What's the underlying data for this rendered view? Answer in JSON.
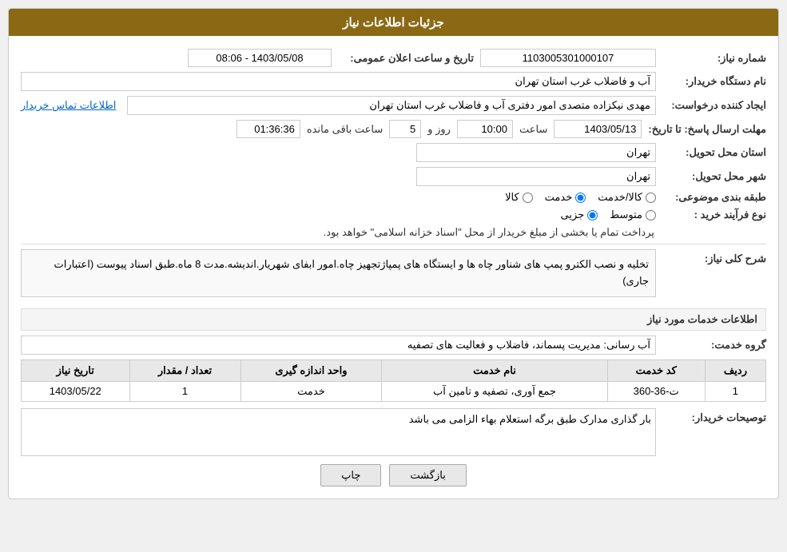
{
  "header": {
    "title": "جزئیات اطلاعات نیاز"
  },
  "fields": {
    "need_number_label": "شماره نیاز:",
    "need_number_value": "1103005301000107",
    "announce_datetime_label": "تاریخ و ساعت اعلان عمومی:",
    "announce_datetime_value": "1403/05/08 - 08:06",
    "buyer_org_label": "نام دستگاه خریدار:",
    "buyer_org_value": "آب و فاضلاب غرب استان تهران",
    "creator_label": "ایجاد کننده درخواست:",
    "creator_value": "مهدی نیکزاده متصدی امور دفتری آب و فاضلاب غرب استان تهران",
    "creator_link": "اطلاعات تماس خریدار",
    "deadline_label": "مهلت ارسال پاسخ: تا تاریخ:",
    "deadline_date": "1403/05/13",
    "deadline_time_label": "ساعت",
    "deadline_time": "10:00",
    "deadline_days_label": "روز و",
    "deadline_days": "5",
    "deadline_remaining_label": "ساعت باقی مانده",
    "deadline_remaining": "01:36:36",
    "province_label": "استان محل تحویل:",
    "province_value": "تهران",
    "city_label": "شهر محل تحویل:",
    "city_value": "تهران",
    "category_label": "طبقه بندی موضوعی:",
    "category_options": [
      {
        "label": "کالا",
        "value": "kala"
      },
      {
        "label": "خدمت",
        "value": "khedmat"
      },
      {
        "label": "کالا/خدمت",
        "value": "kala_khedmat"
      }
    ],
    "category_selected": "khedmat",
    "purchase_type_label": "نوع فرآیند خرید :",
    "purchase_type_options": [
      {
        "label": "جزیی",
        "value": "jozi"
      },
      {
        "label": "متوسط",
        "value": "motavaset"
      }
    ],
    "purchase_type_selected": "jozi",
    "purchase_type_note": "پرداخت تمام یا بخشی از مبلغ خریدار از محل \"اسناد خزانه اسلامی\" خواهد بود.",
    "need_desc_section": "شرح کلی نیاز:",
    "need_desc_value": "تخلیه و نصب الکترو پمپ های شناور چاه ها و ایستگاه های پمپاژتجهیز چاه.امور ابفای شهریار.اندیشه.مدت 8 ماه.طبق اسناد پیوست (اعتبارات جاری)",
    "service_info_section": "اطلاعات خدمات مورد نیاز",
    "service_group_label": "گروه خدمت:",
    "service_group_value": "آب رسانی: مدیریت پسماند، فاضلاب و فعالیت های تصفیه",
    "table": {
      "columns": [
        "ردیف",
        "کد خدمت",
        "نام خدمت",
        "واحد اندازه گیری",
        "تعداد / مقدار",
        "تاریخ نیاز"
      ],
      "rows": [
        {
          "row_num": "1",
          "service_code": "ت-36-360",
          "service_name": "جمع آوری، تصفیه و تامین آب",
          "unit": "خدمت",
          "qty": "1",
          "date": "1403/05/22"
        }
      ]
    },
    "buyer_notes_label": "توصیحات خریدار:",
    "buyer_notes_value": "بار گذاری مدارک طبق برگه استعلام بهاء الزامی می باشد"
  },
  "buttons": {
    "print_label": "چاپ",
    "back_label": "بازگشت"
  }
}
